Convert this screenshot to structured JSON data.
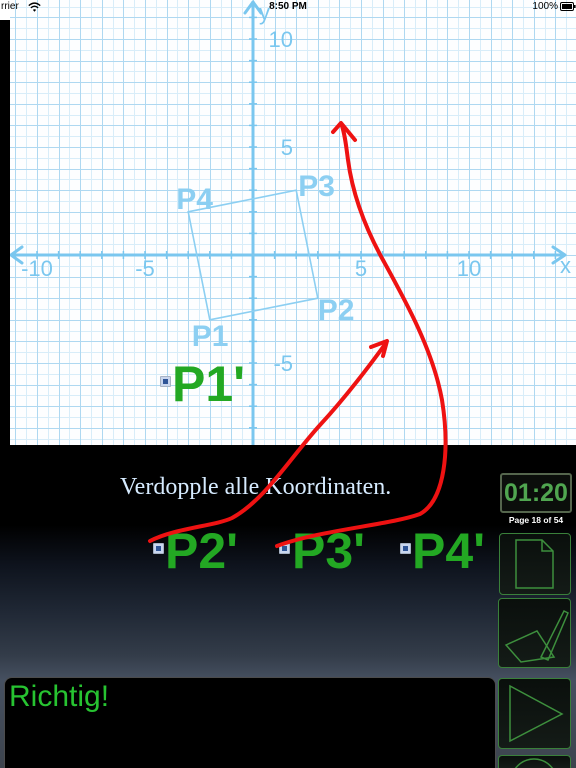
{
  "status_bar": {
    "carrier": "rrier",
    "wifi_icon": "wifi-icon",
    "time": "8:50 PM",
    "battery": "100%",
    "battery_icon": "battery-icon"
  },
  "graph": {
    "x_axis_label": "x",
    "y_axis_label": "y",
    "x_ticks": [
      {
        "value": -10,
        "label": "-10"
      },
      {
        "value": -5,
        "label": "-5"
      },
      {
        "value": 5,
        "label": "5"
      },
      {
        "value": 10,
        "label": "10"
      }
    ],
    "y_ticks": [
      {
        "value": 10,
        "label": "10"
      },
      {
        "value": 5,
        "label": "5"
      },
      {
        "value": -5,
        "label": "-5"
      }
    ],
    "shape_vertices": [
      {
        "label": "P1",
        "x": -2,
        "y": -3
      },
      {
        "label": "P2",
        "x": 3,
        "y": -2
      },
      {
        "label": "P3",
        "x": 2,
        "y": 3
      },
      {
        "label": "P4",
        "x": -3,
        "y": 2
      }
    ]
  },
  "instruction": "Verdopple alle Koordinaten.",
  "answer_labels": [
    {
      "label": "P1'",
      "handle_icon": "drag-handle-icon"
    },
    {
      "label": "P2'",
      "handle_icon": "drag-handle-icon"
    },
    {
      "label": "P3'",
      "handle_icon": "drag-handle-icon"
    },
    {
      "label": "P4'",
      "handle_icon": "drag-handle-icon"
    }
  ],
  "timer": "01:20",
  "page_indicator": "Page 18 of 54",
  "side_buttons": [
    {
      "icon": "page-icon"
    },
    {
      "icon": "pen-check-icon"
    },
    {
      "icon": "play-icon"
    },
    {
      "icon": "circle-icon"
    }
  ],
  "feedback": "Richtig!",
  "colors": {
    "grid_minor": "#d8edf9",
    "grid_major": "#aed8f1",
    "axis": "#7ac7ef",
    "shape": "#8ccff2",
    "answer_label": "#23a823",
    "annotation": "#ee1212",
    "timer_text": "#50a650",
    "feedback_text": "#27c331",
    "button_outline": "#3a803a"
  }
}
